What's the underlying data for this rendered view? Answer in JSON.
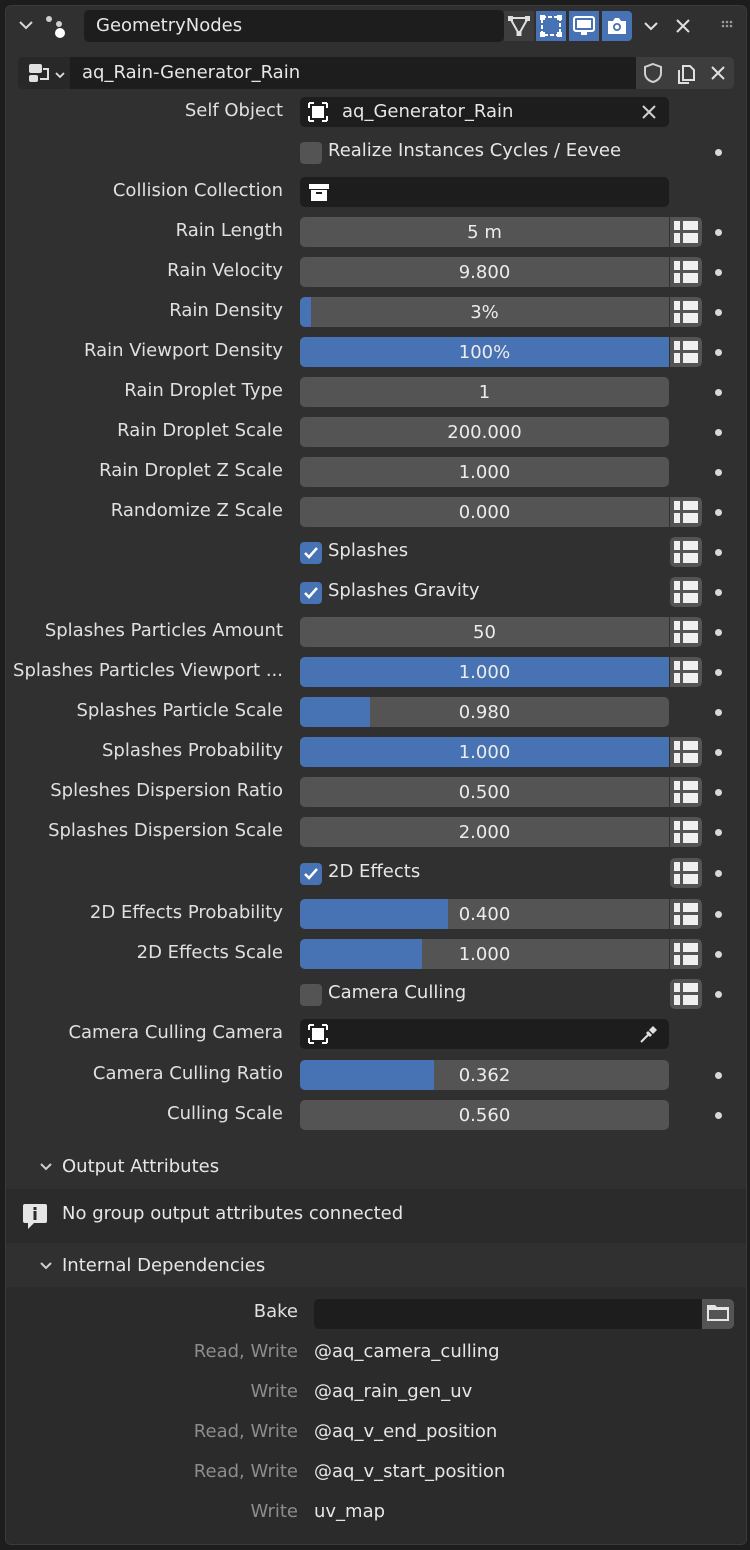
{
  "header": {
    "modifier_name": "GeometryNodes",
    "node_group_name": "aq_Rain-Generator_Rain",
    "icons": [
      "collapse-chevron-icon",
      "geometry-nodes-icon",
      "edit-mode-icon",
      "cage-icon",
      "viewport-display-icon",
      "render-camera-icon",
      "dropdown-chevron-icon",
      "close-icon",
      "drag-handle-icon",
      "node-tree-icon",
      "fake-user-shield-icon",
      "duplicate-icon",
      "unlink-icon"
    ]
  },
  "params": {
    "self_object": {
      "label": "Self Object",
      "value": "aq_Generator_Rain"
    },
    "realize_instances": {
      "label": "Realize Instances Cycles / Eevee",
      "checked": false
    },
    "collision_collection": {
      "label": "Collision Collection",
      "value": ""
    },
    "rain_length": {
      "label": "Rain Length",
      "value": "5 m",
      "fraction": 0
    },
    "rain_velocity": {
      "label": "Rain Velocity",
      "value": "9.800",
      "fraction": 0
    },
    "rain_density": {
      "label": "Rain Density",
      "value": "3%",
      "fraction": 0.03
    },
    "rain_viewport_density": {
      "label": "Rain Viewport Density",
      "value": "100%",
      "fraction": 1.0
    },
    "rain_droplet_type": {
      "label": "Rain Droplet Type",
      "value": "1",
      "fraction": 0
    },
    "rain_droplet_scale": {
      "label": "Rain Droplet Scale",
      "value": "200.000",
      "fraction": 0
    },
    "rain_droplet_z_scale": {
      "label": "Rain Droplet Z Scale",
      "value": "1.000",
      "fraction": 0
    },
    "randomize_z_scale": {
      "label": "Randomize Z Scale",
      "value": "0.000",
      "fraction": 0
    },
    "splashes": {
      "label": "Splashes",
      "checked": true
    },
    "splashes_gravity": {
      "label": "Splashes Gravity",
      "checked": true
    },
    "splashes_particles_amount": {
      "label": "Splashes Particles Amount",
      "value": "50",
      "fraction": 0
    },
    "splashes_particles_viewport": {
      "label": "Splashes Particles Viewport ...",
      "value": "1.000",
      "fraction": 1.0
    },
    "splashes_particle_scale": {
      "label": "Splashes Particle Scale",
      "value": "0.980",
      "fraction": 0.19
    },
    "splashes_probability": {
      "label": "Splashes Probability",
      "value": "1.000",
      "fraction": 1.0
    },
    "spleshes_dispersion_ratio": {
      "label": "Spleshes Dispersion Ratio",
      "value": "0.500",
      "fraction": 0
    },
    "splashes_dispersion_scale": {
      "label": "Splashes Dispersion Scale",
      "value": "2.000",
      "fraction": 0
    },
    "effects_2d": {
      "label": "2D Effects",
      "checked": true
    },
    "effects_2d_probability": {
      "label": "2D Effects Probability",
      "value": "0.400",
      "fraction": 0.4
    },
    "effects_2d_scale": {
      "label": "2D Effects Scale",
      "value": "1.000",
      "fraction": 0.33
    },
    "camera_culling": {
      "label": "Camera Culling",
      "checked": false
    },
    "camera_culling_camera": {
      "label": "Camera Culling Camera",
      "value": ""
    },
    "camera_culling_ratio": {
      "label": "Camera Culling Ratio",
      "value": "0.362",
      "fraction": 0.362
    },
    "culling_scale": {
      "label": "Culling Scale",
      "value": "0.560",
      "fraction": 0
    }
  },
  "output_attributes": {
    "title": "Output Attributes",
    "message": "No group output attributes connected"
  },
  "internal_dependencies": {
    "title": "Internal Dependencies",
    "bake_label": "Bake",
    "rows": [
      {
        "access": "Read, Write",
        "name": "@aq_camera_culling"
      },
      {
        "access": "Write",
        "name": "@aq_rain_gen_uv"
      },
      {
        "access": "Read, Write",
        "name": "@aq_v_end_position"
      },
      {
        "access": "Read, Write",
        "name": "@aq_v_start_position"
      },
      {
        "access": "Write",
        "name": "uv_map"
      }
    ]
  },
  "colors": {
    "accent": "#4772b3",
    "panel": "#303030",
    "field": "#545454",
    "dark_field": "#1d1d1d"
  }
}
